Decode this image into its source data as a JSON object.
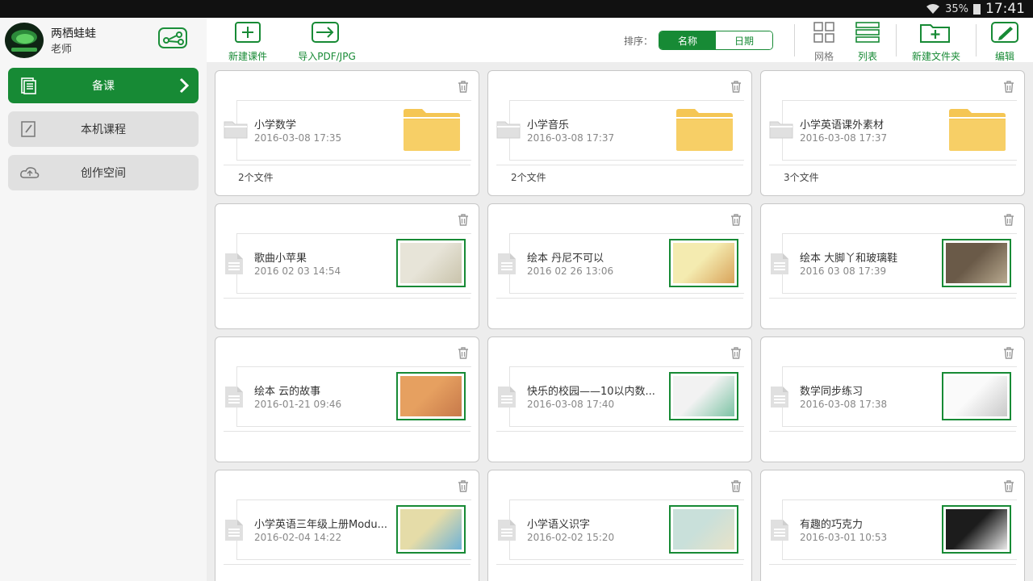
{
  "status_bar": {
    "battery": "35%",
    "time": "17:41"
  },
  "user": {
    "name": "两栖蛙蛙",
    "role": "老师"
  },
  "sidebar": {
    "items": [
      {
        "label": "备课",
        "active": true,
        "icon": "document-stack-icon"
      },
      {
        "label": "本机课程",
        "active": false,
        "icon": "edit-document-icon"
      },
      {
        "label": "创作空间",
        "active": false,
        "icon": "cloud-icon"
      }
    ]
  },
  "toolbar": {
    "new_course": "新建课件",
    "import": "导入PDF/JPG",
    "sort_label": "排序：",
    "sort_name": "名称",
    "sort_date": "日期",
    "grid_view": "网格",
    "list_view": "列表",
    "new_folder": "新建文件夹",
    "edit": "编辑"
  },
  "colors": {
    "accent": "#178a35",
    "folder": "#f5c654"
  },
  "cards": [
    {
      "title": "小学数学",
      "date": "2016-03-08 17:35",
      "count": "2个文件",
      "type": "folder"
    },
    {
      "title": "小学音乐",
      "date": "2016-03-08 17:37",
      "count": "2个文件",
      "type": "folder"
    },
    {
      "title": "小学英语课外素材",
      "date": "2016-03-08 17:37",
      "count": "3个文件",
      "type": "folder"
    },
    {
      "title": "歌曲小苹果",
      "date": "2016 02 03 14:54",
      "count": "",
      "type": "course",
      "thumb": [
        "#e7e4d8",
        "#c9c3ab"
      ]
    },
    {
      "title": "绘本  丹尼不可以",
      "date": "2016 02 26 13:06",
      "count": "",
      "type": "course",
      "thumb": [
        "#f4ebb0",
        "#d9a35a"
      ]
    },
    {
      "title": "绘本 大脚丫和玻璃鞋",
      "date": "2016 03 08 17:39",
      "count": "",
      "type": "course",
      "thumb": [
        "#6a5a48",
        "#b8a98f"
      ]
    },
    {
      "title": "绘本 云的故事",
      "date": "2016-01-21 09:46",
      "count": "",
      "type": "course",
      "thumb": [
        "#e6a060",
        "#c7794a"
      ]
    },
    {
      "title": "快乐的校园——10以内数...",
      "date": "2016-03-08 17:40",
      "count": "",
      "type": "course",
      "thumb": [
        "#f2f2f2",
        "#7cc3a4"
      ]
    },
    {
      "title": "数学同步练习",
      "date": "2016-03-08 17:38",
      "count": "",
      "type": "course",
      "thumb": [
        "#fafafa",
        "#c9c9c9"
      ]
    },
    {
      "title": "小学英语三年级上册Modu...",
      "date": "2016-02-04 14:22",
      "count": "",
      "type": "course",
      "thumb": [
        "#e5dca8",
        "#6fb2d6"
      ]
    },
    {
      "title": "小学语义识字",
      "date": "2016-02-02 15:20",
      "count": "",
      "type": "course",
      "thumb": [
        "#c9e0da",
        "#e8e2c8"
      ]
    },
    {
      "title": "有趣的巧克力",
      "date": "2016-03-01 10:53",
      "count": "",
      "type": "course",
      "thumb": [
        "#1c1c1c",
        "#e9e9e9"
      ]
    }
  ]
}
